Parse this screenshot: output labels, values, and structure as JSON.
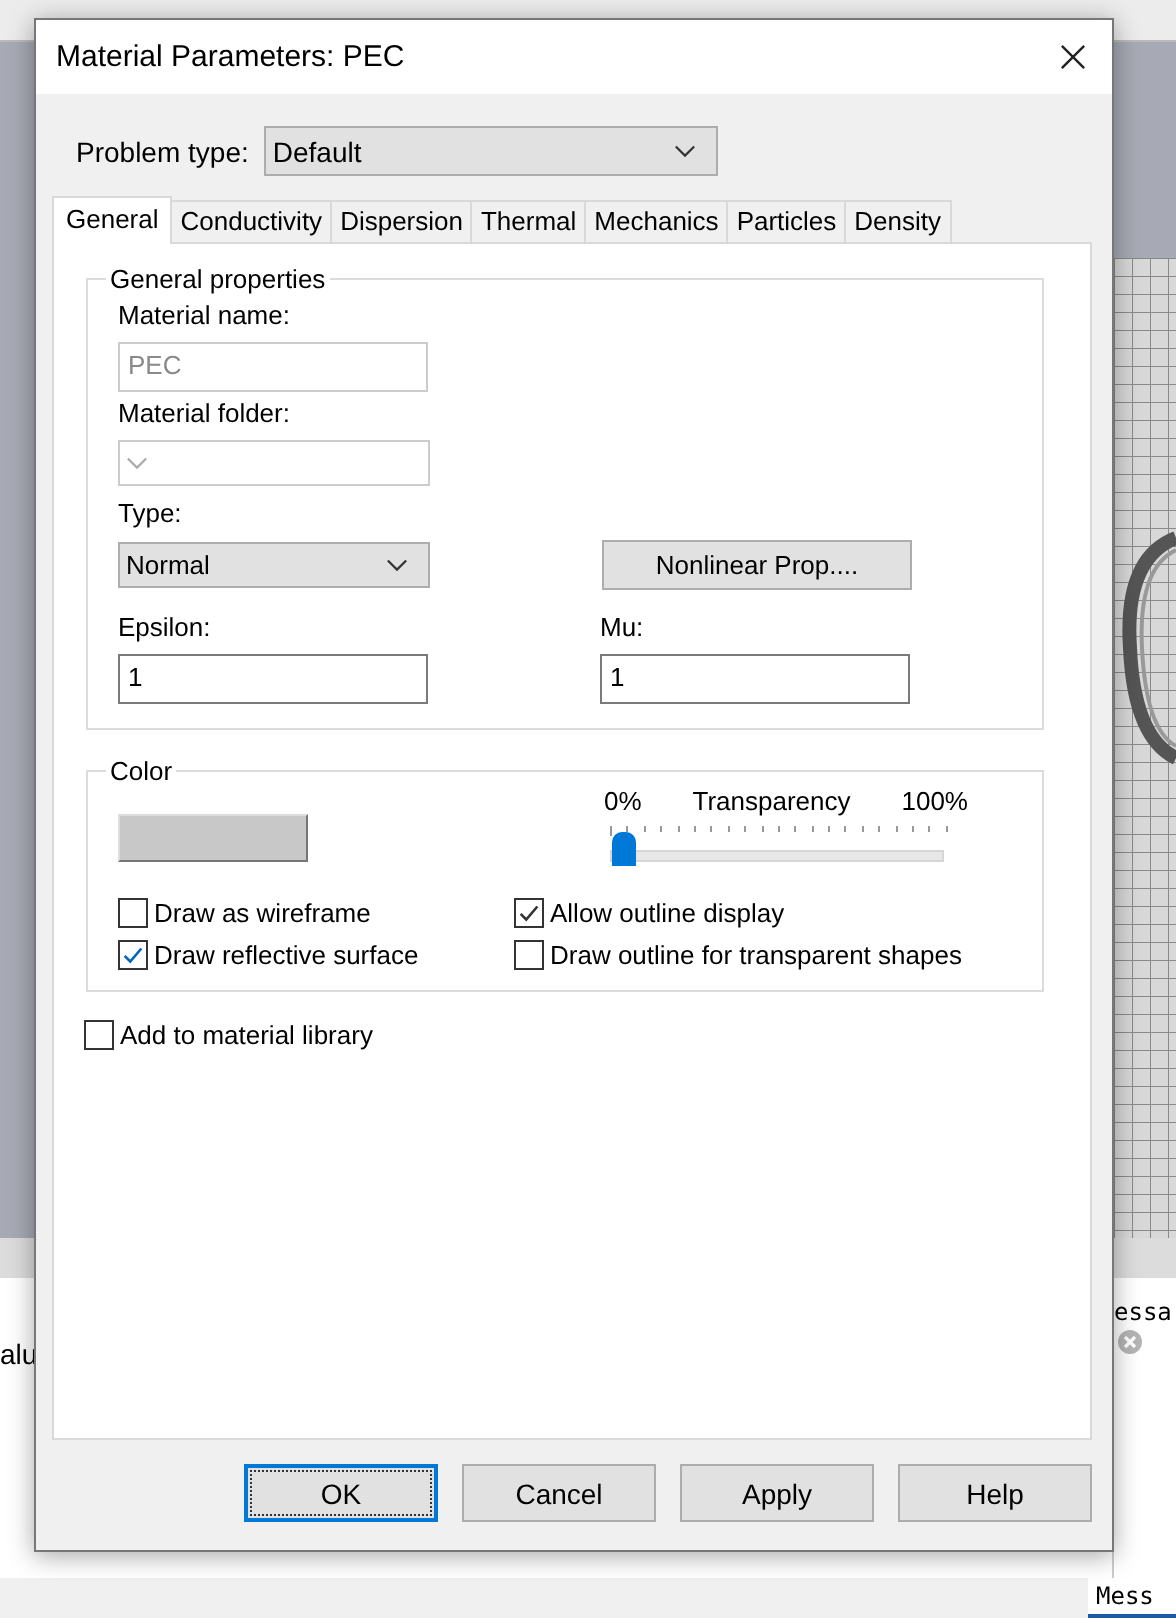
{
  "background_app": {
    "column_header": "alu",
    "panel_title": "essa",
    "tab": "Mess"
  },
  "window": {
    "title": "Material Parameters: PEC"
  },
  "problem_type": {
    "label": "Problem type:",
    "value": "Default"
  },
  "tabs": [
    {
      "label": "General",
      "selected": true
    },
    {
      "label": "Conductivity",
      "selected": false
    },
    {
      "label": "Dispersion",
      "selected": false
    },
    {
      "label": "Thermal",
      "selected": false
    },
    {
      "label": "Mechanics",
      "selected": false
    },
    {
      "label": "Particles",
      "selected": false
    },
    {
      "label": "Density",
      "selected": false
    }
  ],
  "general_properties": {
    "title": "General properties",
    "material_name": {
      "label": "Material name:",
      "value": "PEC",
      "disabled": true
    },
    "material_folder": {
      "label": "Material folder:",
      "disabled": true
    },
    "type": {
      "label": "Type:",
      "value": "Normal"
    },
    "nonlinear_button": "Nonlinear Prop....",
    "epsilon": {
      "label": "Epsilon:",
      "value": "1"
    },
    "mu": {
      "label": "Mu:",
      "value": "1"
    }
  },
  "color": {
    "title": "Color",
    "transparency": {
      "label": "Transparency",
      "min_label": "0%",
      "max_label": "100%",
      "level": 0
    },
    "checkboxes": [
      {
        "label": "Draw as wireframe",
        "checked": false
      },
      {
        "label": "Allow outline display",
        "checked": true
      },
      {
        "label": "Draw reflective surface",
        "checked": true
      },
      {
        "label": "Draw outline for transparent shapes",
        "checked": false
      }
    ]
  },
  "add_to_library": {
    "label": "Add to material library",
    "checked": false
  },
  "buttons": [
    {
      "label": "OK",
      "default": true
    },
    {
      "label": "Cancel",
      "default": false
    },
    {
      "label": "Apply",
      "default": false
    },
    {
      "label": "Help",
      "default": false
    }
  ]
}
